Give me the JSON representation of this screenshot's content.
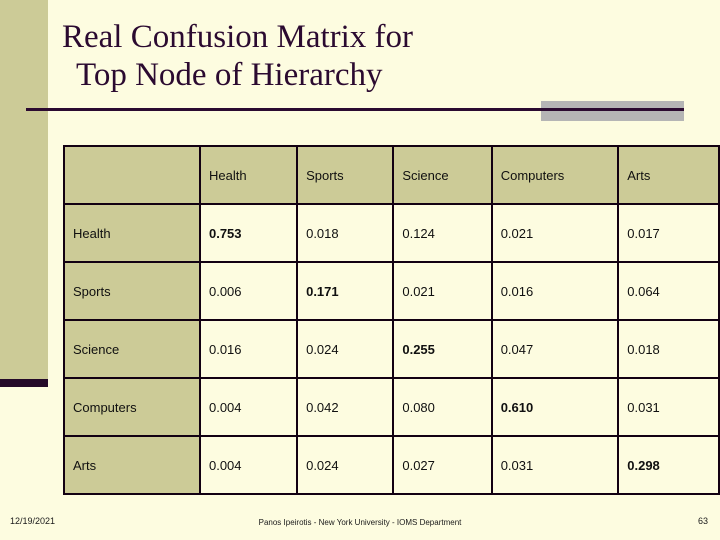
{
  "slide": {
    "title_lines": [
      "Real Confusion Matrix for",
      "Top Node of Hierarchy"
    ],
    "accent_color": "#2B0A30",
    "band_color": "#CCCB97",
    "background_color": "#FDFCE0",
    "gray_tab_color": "#B5B5B5",
    "highlight_color": "#8B1A3A"
  },
  "matrix": {
    "corner_label": "",
    "columns": [
      "Health",
      "Sports",
      "Science",
      "Computers",
      "Arts"
    ],
    "rows": [
      {
        "label": "Health",
        "values": [
          "0.753",
          "0.018",
          "0.124",
          "0.021",
          "0.017"
        ],
        "diagonal_index": 0
      },
      {
        "label": "Sports",
        "values": [
          "0.006",
          "0.171",
          "0.021",
          "0.016",
          "0.064"
        ],
        "diagonal_index": 1
      },
      {
        "label": "Science",
        "values": [
          "0.016",
          "0.024",
          "0.255",
          "0.047",
          "0.018"
        ],
        "diagonal_index": 2
      },
      {
        "label": "Computers",
        "values": [
          "0.004",
          "0.042",
          "0.080",
          "0.610",
          "0.031"
        ],
        "diagonal_index": 3
      },
      {
        "label": "Arts",
        "values": [
          "0.004",
          "0.024",
          "0.027",
          "0.031",
          "0.298"
        ],
        "diagonal_index": 4
      }
    ]
  },
  "footer": {
    "date": "12/19/2021",
    "attribution": "Panos Ipeirotis - New York University - IOMS Department",
    "page_number": "63"
  }
}
